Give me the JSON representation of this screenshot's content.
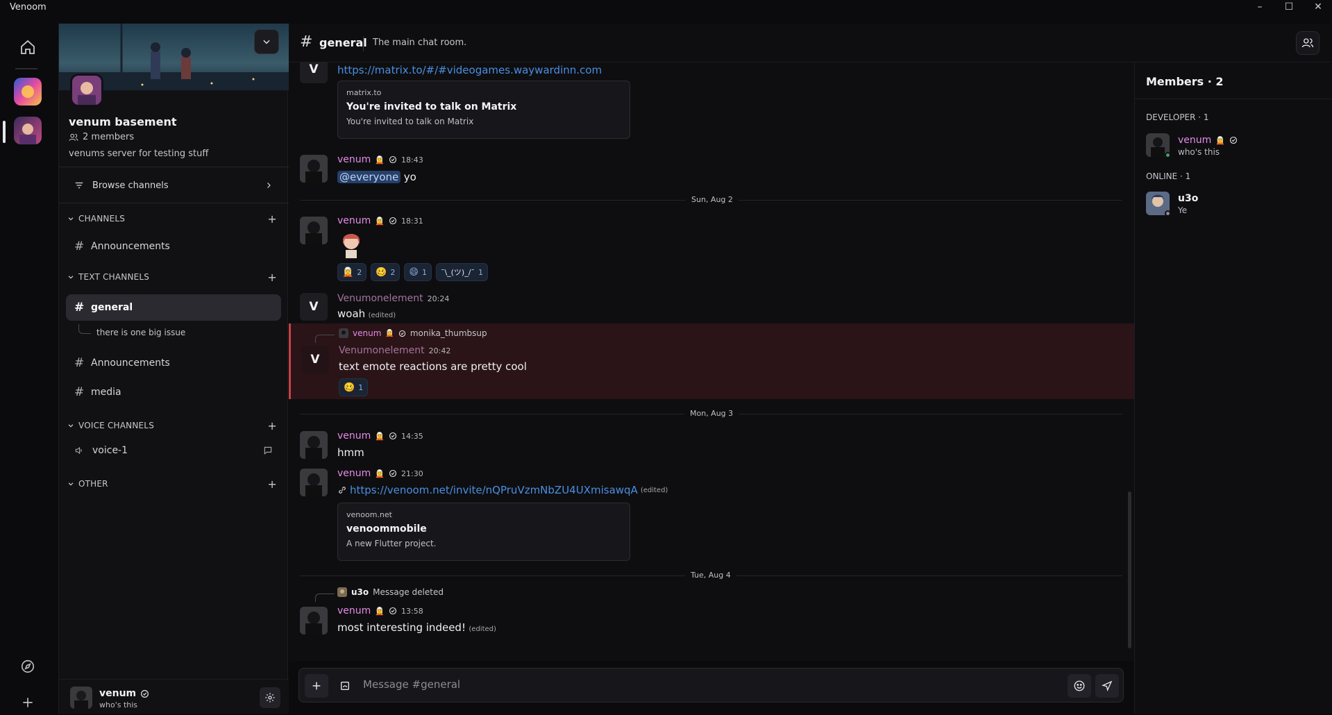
{
  "window": {
    "title": "Venoom"
  },
  "server": {
    "name": "venum basement",
    "member_count": "2 members",
    "description": "venums server for testing stuff",
    "browse_label": "Browse channels"
  },
  "categories": {
    "channels": "CHANNELS",
    "text": "TEXT CHANNELS",
    "voice": "VOICE CHANNELS",
    "other": "OTHER"
  },
  "channels": {
    "announcements_top": "Announcements",
    "general": "general",
    "thread": "there is one big issue",
    "announcements": "Announcements",
    "media": "media",
    "voice1": "voice-1"
  },
  "user": {
    "name": "venum",
    "status": "who's this"
  },
  "header": {
    "channel": "general",
    "topic": "The main chat room."
  },
  "messages": {
    "m0_link": "https://matrix.to/#/#videogames.waywardinn.com",
    "m0_embed_site": "matrix.to",
    "m0_embed_title": "You're invited to talk on Matrix",
    "m0_embed_desc": "You're invited to talk on Matrix",
    "m1_user": "venum",
    "m1_time": "18:43",
    "m1_mention": "@everyone",
    "m1_text": "yo",
    "date1": "Sun, Aug 2",
    "m2_user": "venum",
    "m2_time": "18:31",
    "m2_reactions": [
      {
        "emoji": "🧝",
        "count": "2"
      },
      {
        "emoji": "🥴",
        "count": "2"
      },
      {
        "emoji": "😄",
        "count": "1"
      },
      {
        "emoji": "¯\\_(ツ)_/¯",
        "count": "1"
      }
    ],
    "m3_user": "Venumonelement",
    "m3_time": "20:24",
    "m3_text": "woah",
    "m3_edited": "(edited)",
    "m4_reply_user": "venum",
    "m4_reply_text": "monika_thumbsup",
    "m4_user": "Venumonelement",
    "m4_time": "20:42",
    "m4_text": "text emote reactions are pretty cool",
    "m4_reaction": {
      "emoji": "🥴",
      "count": "1"
    },
    "date2": "Mon, Aug 3",
    "m5_user": "venum",
    "m5_time": "14:35",
    "m5_text": "hmm",
    "m6_user": "venum",
    "m6_time": "21:30",
    "m6_link": "https://venoom.net/invite/nQPruVzmNbZU4UXmisawqA",
    "m6_edited": "(edited)",
    "m6_embed_site": "venoom.net",
    "m6_embed_title": "venoommobile",
    "m6_embed_desc": "A new Flutter project.",
    "date3": "Tue, Aug 4",
    "m7_reply_user": "u3o",
    "m7_reply_text": "Message deleted",
    "m7_user": "venum",
    "m7_time": "13:58",
    "m7_text": "most interesting indeed!",
    "m7_edited": "(edited)"
  },
  "composer": {
    "placeholder": "Message #general"
  },
  "members_panel": {
    "title": "Members · 2",
    "group_dev": "DEVELOPER · 1",
    "dev_name": "venum",
    "dev_status": "who's this",
    "group_online": "ONLINE · 1",
    "online_name": "u3o",
    "online_status": "Ye"
  },
  "colors": {
    "accent_user": "#e58be6",
    "link": "#4a8fe0",
    "highlight": "#c8414a",
    "online": "#3ba55d"
  },
  "icons": [
    "home-icon",
    "compass-icon",
    "plus-icon",
    "gear-icon",
    "members-icon",
    "send-icon",
    "emoji-icon",
    "sticker-icon",
    "hash-icon",
    "speaker-icon",
    "chat-bubble-icon"
  ]
}
